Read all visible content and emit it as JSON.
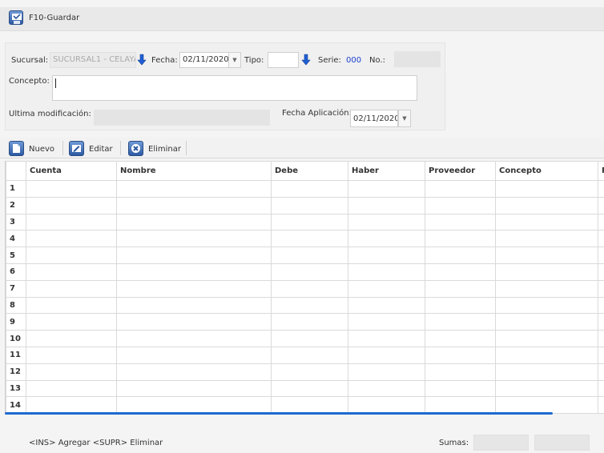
{
  "topbar": {
    "save_label": "F10-Guardar",
    "save_icon": "save-icon"
  },
  "form": {
    "sucursal_label": "Sucursal:",
    "sucursal_value": "SUCURSAL1 - CELAYA",
    "fecha_label": "Fecha:",
    "fecha_value": "02/11/2020",
    "tipo_label": "Tipo:",
    "tipo_value": "",
    "serie_label": "Serie:",
    "serie_value": "000",
    "no_label": "No.:",
    "no_value": "",
    "concepto_label": "Concepto:",
    "concepto_value": "",
    "ultima_mod_label": "Ultima modificación:",
    "ultima_mod_value": "",
    "fecha_aplicacion_label": "Fecha Aplicación:",
    "fecha_aplicacion_value": "02/11/2020"
  },
  "toolbar": {
    "nuevo_label": "Nuevo",
    "editar_label": "Editar",
    "eliminar_label": "Eliminar"
  },
  "grid": {
    "columns": [
      "Cuenta",
      "Nombre",
      "Debe",
      "Haber",
      "Proveedor",
      "Concepto",
      "R"
    ],
    "row_numbers": [
      "1",
      "2",
      "3",
      "4",
      "5",
      "6",
      "7",
      "8",
      "9",
      "10",
      "11",
      "12",
      "13",
      "14"
    ]
  },
  "footer": {
    "hint_text": "<INS> Agregar   <SUPR> Eliminar",
    "sumas_label": "Sumas:",
    "suma_debe": "",
    "suma_haber": ""
  },
  "colors": {
    "accent": "#1e6ad1",
    "serie_blue": "#1a3fd1",
    "icon_blue": "#2d5aa2"
  }
}
